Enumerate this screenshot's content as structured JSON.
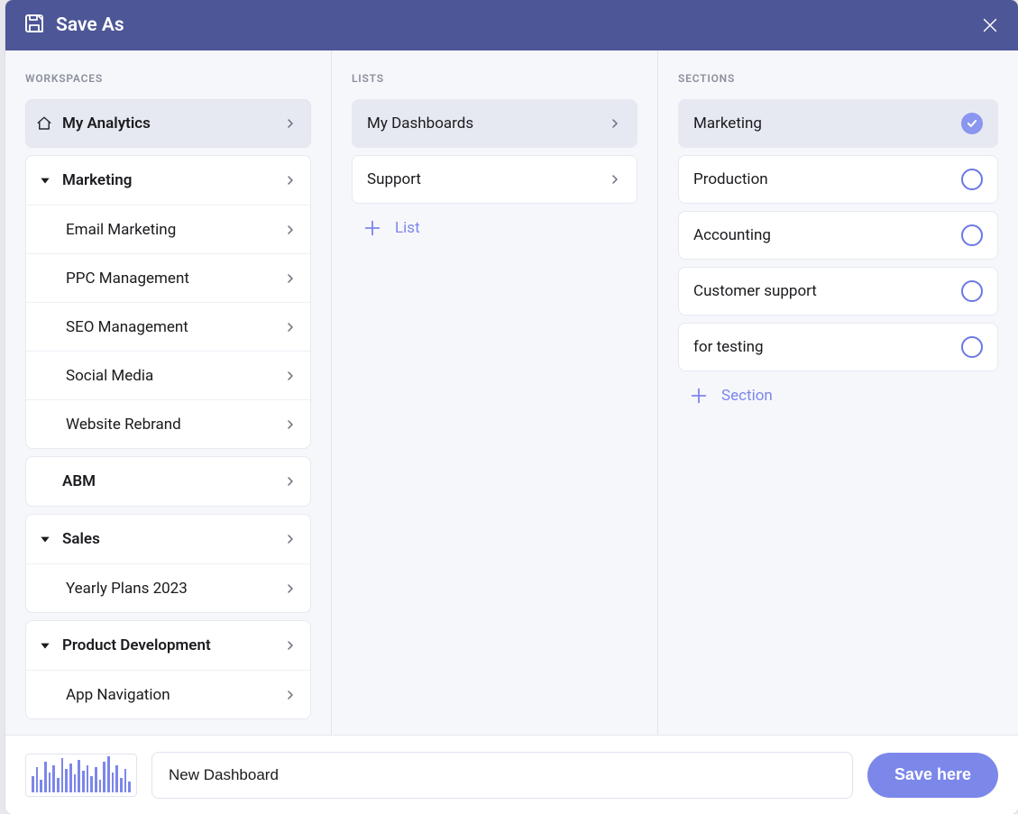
{
  "header": {
    "title": "Save As"
  },
  "columns": {
    "workspaces_label": "WORKSPACES",
    "lists_label": "LISTS",
    "sections_label": "SECTIONS"
  },
  "workspaces": {
    "my_analytics": "My Analytics",
    "groups": [
      {
        "name": "Marketing",
        "children": [
          "Email Marketing",
          "PPC Management",
          "SEO Management",
          "Social Media",
          "Website Rebrand"
        ]
      },
      {
        "name": "ABM",
        "children": []
      },
      {
        "name": "Sales",
        "children": [
          "Yearly Plans 2023"
        ]
      },
      {
        "name": "Product Development",
        "children": [
          "App Navigation"
        ]
      }
    ]
  },
  "lists": {
    "items": [
      {
        "label": "My Dashboards",
        "selected": true
      },
      {
        "label": "Support",
        "selected": false
      }
    ],
    "add_label": "List"
  },
  "sections": {
    "items": [
      {
        "label": "Marketing",
        "selected": true
      },
      {
        "label": "Production",
        "selected": false
      },
      {
        "label": "Accounting",
        "selected": false
      },
      {
        "label": "Customer support",
        "selected": false
      },
      {
        "label": "for testing",
        "selected": false
      }
    ],
    "add_label": "Section"
  },
  "footer": {
    "name_value": "New Dashboard",
    "save_label": "Save here"
  }
}
